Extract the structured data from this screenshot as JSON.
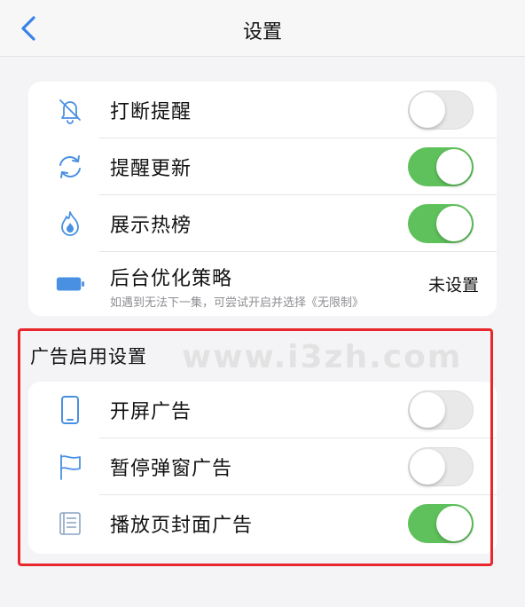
{
  "nav": {
    "title": "设置"
  },
  "general": {
    "items": [
      {
        "label": "打断提醒",
        "icon": "bell-slash-icon",
        "on": false
      },
      {
        "label": "提醒更新",
        "icon": "refresh-icon",
        "on": true
      },
      {
        "label": "展示热榜",
        "icon": "flame-icon",
        "on": true
      },
      {
        "label": "后台优化策略",
        "icon": "battery-icon",
        "sub": "如遇到无法下一集，可尝试开启并选择《无限制》",
        "value": "未设置"
      }
    ]
  },
  "ads": {
    "title": "广告启用设置",
    "items": [
      {
        "label": "开屏广告",
        "icon": "phone-icon",
        "on": false
      },
      {
        "label": "暂停弹窗广告",
        "icon": "flag-icon",
        "on": false
      },
      {
        "label": "播放页封面广告",
        "icon": "document-icon",
        "on": true
      }
    ]
  },
  "watermark": "www.i3zh.com",
  "colors": {
    "accent": "#4a90e2",
    "toggle_on": "#5fc15b",
    "highlight": "#e8262b"
  }
}
